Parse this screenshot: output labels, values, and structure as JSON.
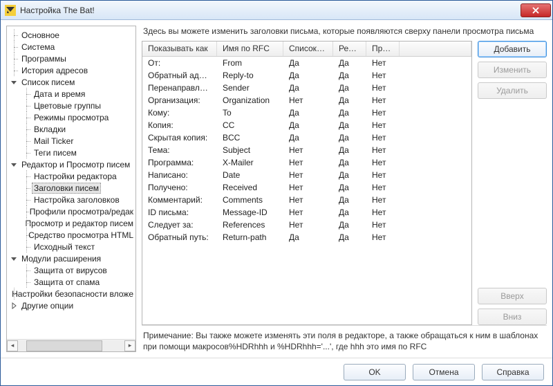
{
  "window": {
    "title": "Настройка The Bat!"
  },
  "tree": {
    "items": [
      {
        "label": "Основное",
        "exp": "none"
      },
      {
        "label": "Система",
        "exp": "none"
      },
      {
        "label": "Программы",
        "exp": "none"
      },
      {
        "label": "История адресов",
        "exp": "none"
      },
      {
        "label": "Список писем",
        "exp": "open",
        "children": [
          {
            "label": "Дата и время"
          },
          {
            "label": "Цветовые группы"
          },
          {
            "label": "Режимы просмотра"
          },
          {
            "label": "Вкладки"
          },
          {
            "label": "Mail Ticker"
          },
          {
            "label": "Теги писем"
          }
        ]
      },
      {
        "label": "Редактор и Просмотр писем",
        "exp": "open",
        "children": [
          {
            "label": "Настройки редактора"
          },
          {
            "label": "Заголовки писем",
            "selected": true
          },
          {
            "label": "Настройка заголовков"
          },
          {
            "label": "Профили просмотра/редак"
          },
          {
            "label": "Просмотр и редактор писем"
          },
          {
            "label": "Средство просмотра HTML"
          },
          {
            "label": "Исходный текст"
          }
        ]
      },
      {
        "label": "Модули расширения",
        "exp": "open",
        "children": [
          {
            "label": "Защита от вирусов"
          },
          {
            "label": "Защита от спама"
          }
        ]
      },
      {
        "label": "Настройки безопасности вложе",
        "exp": "none"
      },
      {
        "label": "Другие опции",
        "exp": "closed"
      }
    ]
  },
  "description": "Здесь вы можете изменить заголовки письма, которые появляются сверху панели просмотра письма",
  "table": {
    "columns": [
      "Показывать как",
      "Имя по RFC",
      "Список а…",
      "Ред…",
      "Пр…"
    ],
    "rows": [
      [
        "От:",
        "From",
        "Да",
        "Да",
        "Нет"
      ],
      [
        "Обратный адр…",
        "Reply-to",
        "Да",
        "Да",
        "Нет"
      ],
      [
        "Перенаправле…",
        "Sender",
        "Да",
        "Да",
        "Нет"
      ],
      [
        "Организация:",
        "Organization",
        "Нет",
        "Да",
        "Нет"
      ],
      [
        "Кому:",
        "To",
        "Да",
        "Да",
        "Нет"
      ],
      [
        "Копия:",
        "CC",
        "Да",
        "Да",
        "Нет"
      ],
      [
        "Скрытая копия:",
        "BCC",
        "Да",
        "Да",
        "Нет"
      ],
      [
        "Тема:",
        "Subject",
        "Нет",
        "Да",
        "Нет"
      ],
      [
        "Программа:",
        "X-Mailer",
        "Нет",
        "Да",
        "Нет"
      ],
      [
        "Написано:",
        "Date",
        "Нет",
        "Да",
        "Нет"
      ],
      [
        "Получено:",
        "Received",
        "Нет",
        "Да",
        "Нет"
      ],
      [
        "Комментарий:",
        "Comments",
        "Нет",
        "Да",
        "Нет"
      ],
      [
        "ID письма:",
        "Message-ID",
        "Нет",
        "Да",
        "Нет"
      ],
      [
        "Следует за:",
        "References",
        "Нет",
        "Да",
        "Нет"
      ],
      [
        "Обратный путь:",
        "Return-path",
        "Да",
        "Да",
        "Нет"
      ]
    ]
  },
  "buttons": {
    "add": "Добавить",
    "edit": "Изменить",
    "delete": "Удалить",
    "up": "Вверх",
    "down": "Вниз"
  },
  "note": "Примечание: Вы также можете изменять эти поля в редакторе, а также обращаться к ним в шаблонах при помощи макросов%HDRhhh и %HDRhhh='...', где hhh это имя по RFC",
  "footer": {
    "ok": "OK",
    "cancel": "Отмена",
    "help": "Справка"
  }
}
